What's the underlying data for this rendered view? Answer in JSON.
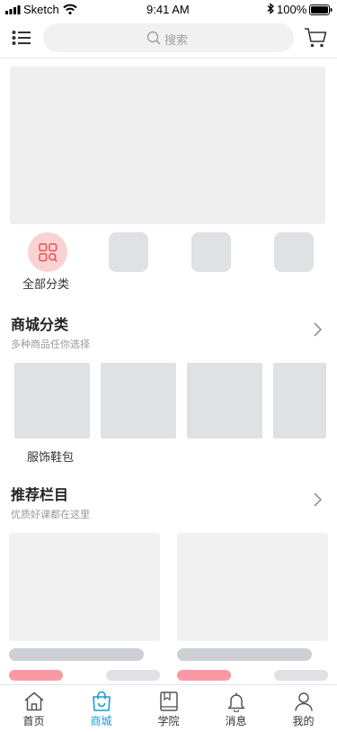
{
  "status": {
    "carrier": "Sketch",
    "time": "9:41 AM",
    "battery": "100%"
  },
  "header": {
    "search_placeholder": "搜索",
    "menu_icon": "list-icon",
    "cart_icon": "cart-icon"
  },
  "quick_categories": [
    {
      "label": "全部分类",
      "icon": "grid-search-icon"
    }
  ],
  "mall_section": {
    "title": "商城分类",
    "subtitle": "多种商品任你选择",
    "items": [
      {
        "label": "服饰鞋包"
      }
    ]
  },
  "recommend_section": {
    "title": "推荐栏目",
    "subtitle": "优质好课都在这里"
  },
  "tabs": [
    {
      "label": "首页",
      "icon": "home-icon"
    },
    {
      "label": "商城",
      "icon": "shopping-bag-icon"
    },
    {
      "label": "学院",
      "icon": "book-icon"
    },
    {
      "label": "消息",
      "icon": "bell-icon"
    },
    {
      "label": "我的",
      "icon": "user-icon"
    }
  ],
  "colors": {
    "accent": "#1a9bd7",
    "category_icon": "#f0504f",
    "category_bg": "#f9d3d3",
    "price_pill": "#f99aa3"
  }
}
